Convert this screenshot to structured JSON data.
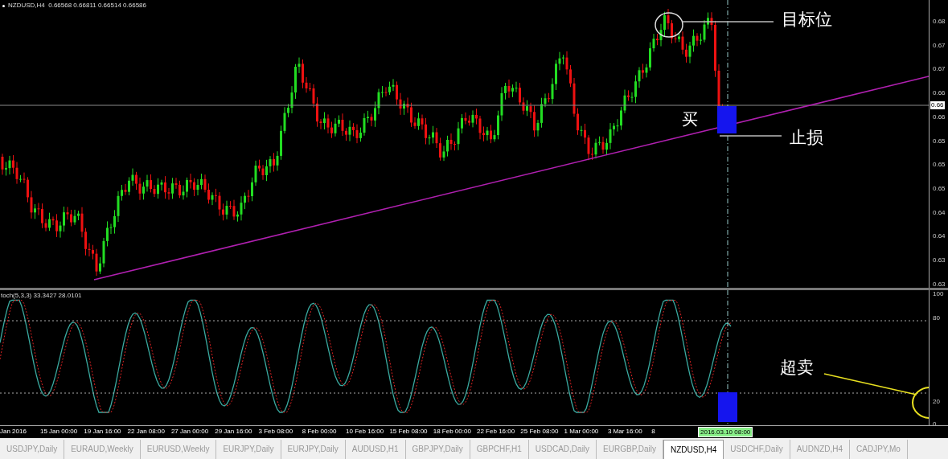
{
  "chart": {
    "header": "NZDUSD,H4  0.66568 0.66811 0.66514 0.66586",
    "price_ticks": [
      "0.68",
      "0.67",
      "0.67",
      "0.66",
      "0.66",
      "0.65",
      "0.65",
      "0.65",
      "0.64",
      "0.64",
      "0.63",
      "0.63"
    ],
    "current_price": "0.66",
    "annotations": [
      {
        "kind": "target",
        "text": "目标位"
      },
      {
        "kind": "buy",
        "text": "买"
      },
      {
        "kind": "stop",
        "text": "止损"
      }
    ]
  },
  "oscillator": {
    "header": "toch(5,3,3) 33.3427 28.0101",
    "levels": [
      "100",
      "80",
      "20",
      "0"
    ],
    "annotation": {
      "kind": "oversold",
      "text": "超卖"
    }
  },
  "time_axis": {
    "labels": [
      "Jan 2016",
      "15 Jan 00:00",
      "19 Jan 16:00",
      "22 Jan 08:00",
      "27 Jan 00:00",
      "29 Jan 16:00",
      "3 Feb 08:00",
      "8 Feb 00:00",
      "10 Feb 16:00",
      "15 Feb 08:00",
      "18 Feb 00:00",
      "22 Feb 16:00",
      "25 Feb 08:00",
      "1 Mar 00:00",
      "3 Mar 16:00",
      "8"
    ],
    "cursor_time": "2016.03.10 08:00"
  },
  "tabs": [
    {
      "label": "USDJPY,Daily",
      "selected": false
    },
    {
      "label": "EURAUD,Weekly",
      "selected": false
    },
    {
      "label": "EURUSD,Weekly",
      "selected": false
    },
    {
      "label": "EURJPY,Daily",
      "selected": false
    },
    {
      "label": "EURJPY,Daily",
      "selected": false
    },
    {
      "label": "AUDUSD,H1",
      "selected": false
    },
    {
      "label": "GBPJPY,Daily",
      "selected": false
    },
    {
      "label": "GBPCHF,H1",
      "selected": false
    },
    {
      "label": "USDCAD,Daily",
      "selected": false
    },
    {
      "label": "EURGBP,Daily",
      "selected": false
    },
    {
      "label": "NZDUSD,H4",
      "selected": true
    },
    {
      "label": "USDCHF,Daily",
      "selected": false
    },
    {
      "label": "AUDNZD,H4",
      "selected": false
    },
    {
      "label": "CADJPY,Mo",
      "selected": false
    }
  ]
}
